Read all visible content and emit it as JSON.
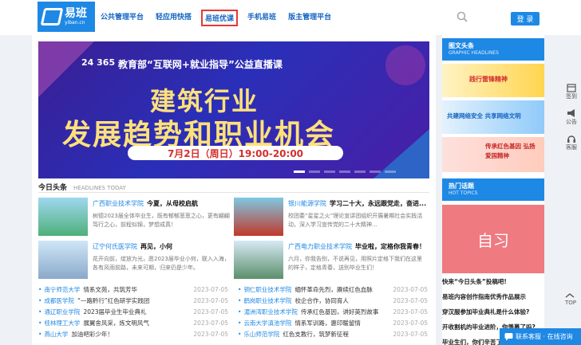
{
  "logo": {
    "cn": "易班",
    "en": "yiban.cn"
  },
  "nav": [
    "公共管理平台",
    "轻应用快搭",
    "易班优课",
    "手机易班",
    "版主管理平台"
  ],
  "login_label": "登 录",
  "banner": {
    "badge": "24 365",
    "subtitle": "教育部“互联网+就业指导”公益直播课",
    "title_line1": "建筑行业",
    "title_line2": "发展趋势和职业机会",
    "date": "7月2日（周日）19:00-20:00"
  },
  "section": {
    "title": "今日头条",
    "en": "HEADLINES TODAY"
  },
  "news": [
    {
      "src": "广西职业技术学院",
      "title": "今夏，从母校启航",
      "summary": "树德2023届全体毕业生，既有郁郁葱葱之心，更有翩翩笃行之心，前程似锦，梦想成真！"
    },
    {
      "src": "银川能源学院",
      "title": "学习二十大，永远跟党走，奋进...",
      "summary": "校团委“星星之火”理论宣讲团组织开展暑期社会实践活动，深入学习宣传党的二十大精神..."
    },
    {
      "src": "辽宁何氏医学院",
      "title": "再见，小何",
      "summary": "花开向前，绽放为光，愿2023届毕业小何，联入入海，各有风雨前路，未来可期，归来仍是少年。"
    },
    {
      "src": "广西电力职业技术学院",
      "title": "毕业啦，定格你我青春！",
      "summary": "六月，你我告别，不说再见，用照片定格下我们在这里的样子，定格青春，送别毕业生们！"
    }
  ],
  "list_left": [
    {
      "src": "南宁师范大学",
      "title": "情系文苑，共筑芳华",
      "date": "2023-07-05"
    },
    {
      "src": "成都医学院",
      "title": "“一路黔行”红色研学实践团",
      "date": "2023-07-05"
    },
    {
      "src": "通辽职业学院",
      "title": "2023届毕业生毕业典礼",
      "date": "2023-07-05"
    },
    {
      "src": "桂林理工大学",
      "title": "展翼舍风采，炼文明风气",
      "date": "2023-07-05"
    },
    {
      "src": "燕山大学",
      "title": "加油吧彩少年！",
      "date": "2023-07-05"
    }
  ],
  "list_right": [
    {
      "src": "铜仁职业技术学院",
      "title": "缅怀革命先烈，赓续红色血脉",
      "date": "2023-07-05"
    },
    {
      "src": "鹤岗职业技术学院",
      "title": "校企合作，协同育人",
      "date": "2023-07-05"
    },
    {
      "src": "湄洲湾职业技术学院",
      "title": "传承红色基因，讲好英烈故事",
      "date": "2023-07-05"
    },
    {
      "src": "云南大学滇池学院",
      "title": "情系军训路，惠印暖留情",
      "date": "2023-07-05"
    },
    {
      "src": "乐山师范学院",
      "title": "红色支教行，筑梦新征程",
      "date": "2023-07-05"
    }
  ],
  "side": {
    "headline_cn": "图文头条",
    "headline_en": "GRAPHIC HEADLINES",
    "img_texts": [
      "践行雷锋精神",
      "共建网络安全 共享网络文明",
      "传承红色基因 弘扬爱国精神"
    ],
    "hot_cn": "热门话题",
    "hot_en": "HOT TOPICS",
    "hot_img": "自习",
    "questions": [
      "快来“今日头条”投稿吧!",
      "易班内容创作指南优秀作品展示",
      "穿汉服参加毕业典礼是什么体验?",
      "开收割机的毕业进阶，你羡慕了吗?",
      "毕业生们，你们辛苦了"
    ]
  },
  "rail": [
    "签到",
    "公告",
    "客服"
  ],
  "top_label": "TOP",
  "chat_label": "联系客服 · 在线咨询"
}
